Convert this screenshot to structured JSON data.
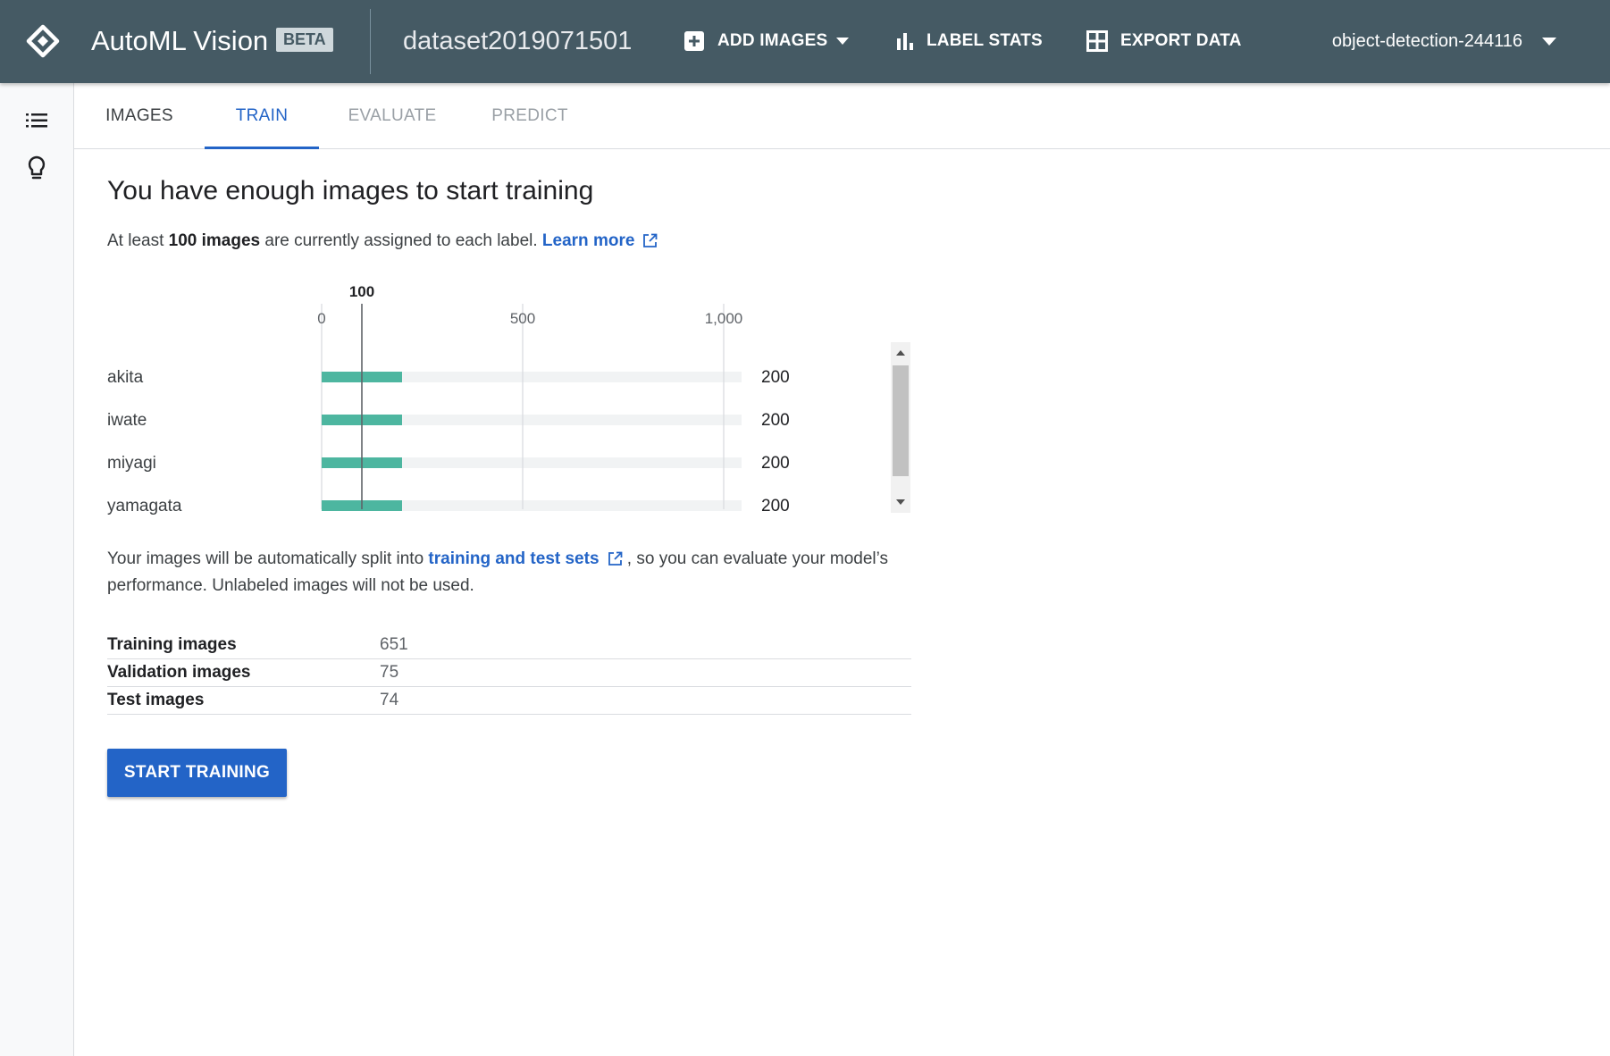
{
  "header": {
    "app_title": "AutoML Vision",
    "badge": "BETA",
    "dataset": "dataset2019071501",
    "actions": {
      "add_images": "ADD IMAGES",
      "label_stats": "LABEL STATS",
      "export_data": "EXPORT DATA"
    },
    "project": "object-detection-244116"
  },
  "rail": {
    "icons": [
      "list-icon",
      "lightbulb-icon"
    ]
  },
  "tabs": [
    {
      "label": "IMAGES",
      "state": "default"
    },
    {
      "label": "TRAIN",
      "state": "active"
    },
    {
      "label": "EVALUATE",
      "state": "disabled"
    },
    {
      "label": "PREDICT",
      "state": "disabled"
    }
  ],
  "main": {
    "heading": "You have enough images to start training",
    "intro_prefix": "At least ",
    "intro_bold": "100 images",
    "intro_suffix": " are currently assigned to each label. ",
    "learn_more": "Learn more",
    "split_prefix": "Your images will be automatically split into ",
    "split_link": "training and test sets",
    "split_suffix": " , so you can evaluate your model’s performance. Unlabeled images will not be used.",
    "split_rows": [
      {
        "label": "Training images",
        "value": "651"
      },
      {
        "label": "Validation images",
        "value": "75"
      },
      {
        "label": "Test images",
        "value": "74"
      }
    ],
    "start_button": "START TRAINING"
  },
  "chart_data": {
    "type": "bar",
    "orientation": "horizontal",
    "categories": [
      "akita",
      "iwate",
      "miyagi",
      "yamagata"
    ],
    "values": [
      200,
      200,
      200,
      200
    ],
    "value_labels": [
      "200",
      "200",
      "200",
      "200"
    ],
    "xlim": [
      0,
      1000
    ],
    "ticks": [
      0,
      500,
      1000
    ],
    "tick_labels": [
      "0",
      "500",
      "1,000"
    ],
    "threshold": 100,
    "threshold_label": "100",
    "bar_color": "#4db6a0",
    "track_color": "#f1f3f4",
    "grid": true
  },
  "colors": {
    "header_bg": "#455a64",
    "accent": "#2364c7"
  }
}
